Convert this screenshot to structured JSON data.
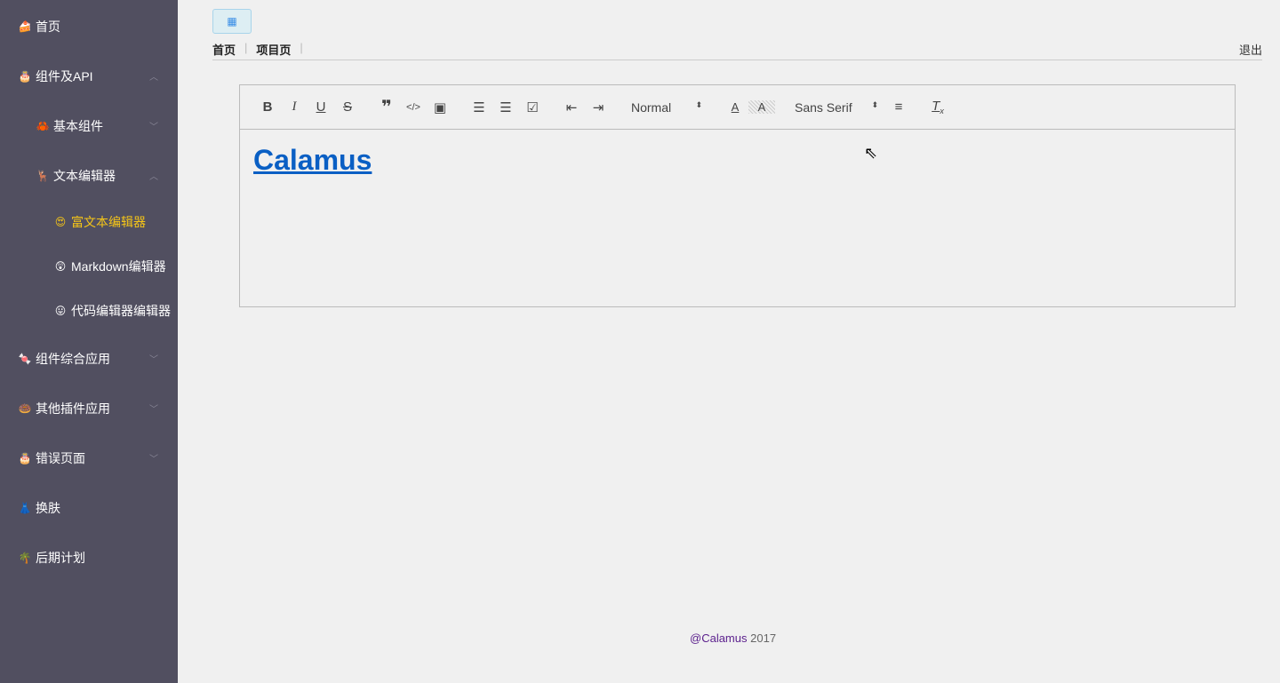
{
  "sidebar": {
    "items": [
      {
        "label": "首页",
        "icon": "🍰"
      },
      {
        "label": "组件及API",
        "icon": "🎂"
      },
      {
        "label": "基本组件",
        "icon": "🦀"
      },
      {
        "label": "文本编辑器",
        "icon": "🦌"
      },
      {
        "label": "富文本编辑器",
        "icon": "😍"
      },
      {
        "label": "Markdown编辑器",
        "icon": "😲"
      },
      {
        "label": "代码编辑器编辑器",
        "icon": "😛"
      },
      {
        "label": "组件综合应用",
        "icon": "🍬"
      },
      {
        "label": "其他插件应用",
        "icon": "🍩"
      },
      {
        "label": "错误页面",
        "icon": "🎂"
      },
      {
        "label": "换肤",
        "icon": "👗"
      },
      {
        "label": "后期计划",
        "icon": "🌴"
      }
    ]
  },
  "header": {
    "crumbs": [
      "首页",
      "项目页"
    ],
    "logout": "退出"
  },
  "editor": {
    "header_select": "Normal",
    "font_select": "Sans Serif",
    "content": "Calamus"
  },
  "footer": {
    "author": "@Calamus",
    "year": "2017"
  }
}
